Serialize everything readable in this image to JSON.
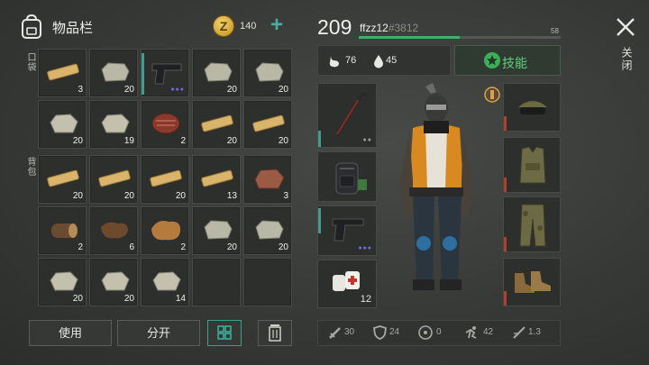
{
  "header": {
    "title": "物品栏",
    "coins": "140",
    "add_symbol": "+",
    "coin_symbol": "Z"
  },
  "sections": {
    "pocket": "口袋",
    "backpack": "背包"
  },
  "inventory": [
    {
      "icon": "wood-plank-icon",
      "count": "3"
    },
    {
      "icon": "stone-icon",
      "count": "20"
    },
    {
      "icon": "pistol-icon",
      "count": "",
      "quality_dots": "●●●",
      "durability": true
    },
    {
      "icon": "stone-icon",
      "count": "20"
    },
    {
      "icon": "stone-icon",
      "count": "20"
    },
    {
      "icon": "limestone-icon",
      "count": "20"
    },
    {
      "icon": "limestone-icon",
      "count": "19"
    },
    {
      "icon": "steak-icon",
      "count": "2"
    },
    {
      "icon": "wood-plank-icon",
      "count": "20"
    },
    {
      "icon": "wood-plank-icon",
      "count": "20"
    },
    {
      "icon": "wood-plank-icon",
      "count": "20"
    },
    {
      "icon": "wood-plank-icon",
      "count": "20"
    },
    {
      "icon": "wood-plank-icon",
      "count": "20"
    },
    {
      "icon": "wood-plank-icon",
      "count": "13"
    },
    {
      "icon": "iron-ore-icon",
      "count": "3"
    },
    {
      "icon": "log-icon",
      "count": "2"
    },
    {
      "icon": "leather-icon",
      "count": "6"
    },
    {
      "icon": "fur-icon",
      "count": "2"
    },
    {
      "icon": "stone-icon",
      "count": "20"
    },
    {
      "icon": "stone-icon",
      "count": "20"
    },
    {
      "icon": "limestone-icon",
      "count": "20"
    },
    {
      "icon": "limestone-icon",
      "count": "20"
    },
    {
      "icon": "limestone-icon",
      "count": "14"
    },
    {
      "icon": "",
      "count": ""
    },
    {
      "icon": "",
      "count": ""
    }
  ],
  "buttons": {
    "use": "使用",
    "split": "分开"
  },
  "player": {
    "level": "209",
    "name": "ffzz12",
    "id": "#3812",
    "xp_progress": 0.5,
    "xp_label": "58",
    "food": "76",
    "water": "45",
    "skills_label": "技能"
  },
  "close_label": "关闭",
  "equipment": {
    "left": [
      {
        "icon": "crowbar-icon",
        "count": "",
        "dots": "●●"
      },
      {
        "icon": "backpack-icon",
        "count": ""
      },
      {
        "icon": "pistol-icon",
        "count": "",
        "dots": "●●●"
      },
      {
        "icon": "bandage-icon",
        "count": "12"
      }
    ],
    "right": [
      {
        "icon": "helmet-goggles-icon"
      },
      {
        "icon": "body-armor-icon"
      },
      {
        "icon": "camo-pants-icon"
      },
      {
        "icon": "boots-icon"
      }
    ]
  },
  "stats": {
    "attack": "30",
    "defense": "24",
    "radiation": "0",
    "speed": "42",
    "stealth": "1.3"
  },
  "colors": {
    "accent": "#3f9c8e",
    "xp": "#3fb06a",
    "skills": "#5fcf7a",
    "durability_low": "#b13f2a",
    "quality": "#6b6fe0"
  }
}
